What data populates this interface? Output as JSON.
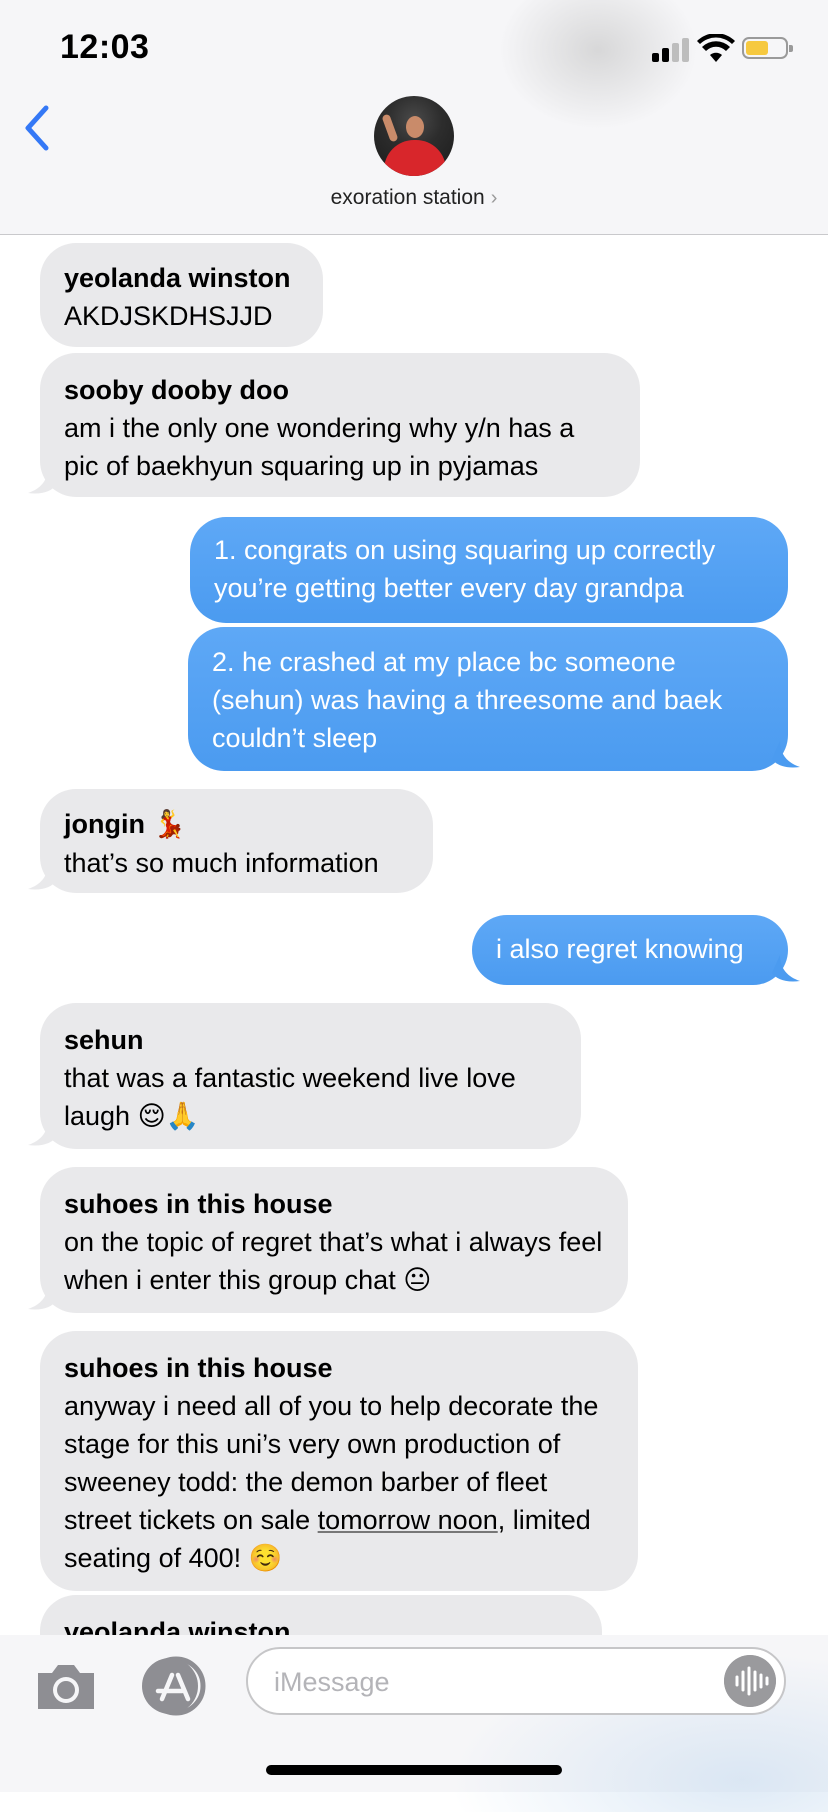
{
  "status_bar": {
    "time": "12:03",
    "battery_color": "#f6c940"
  },
  "header": {
    "contact_name": "exoration station",
    "avatar_icon": "group-avatar"
  },
  "messages": [
    {
      "direction": "in",
      "sender": "yeolanda winston",
      "text": "AKDJSKDHSJJD"
    },
    {
      "direction": "in",
      "sender": "sooby dooby doo",
      "text": "am i the only one wondering why y/n has a pic of baekhyun squaring up in pyjamas"
    },
    {
      "direction": "out",
      "text": "1. congrats on using squaring up correctly you’re getting better every day grandpa"
    },
    {
      "direction": "out",
      "text": "2. he crashed at my place bc someone (sehun) was having a threesome and baek couldn’t sleep"
    },
    {
      "direction": "in",
      "sender": "jongin",
      "sender_emoji": "💃",
      "text": "that’s so much information"
    },
    {
      "direction": "out",
      "text": "i also regret knowing"
    },
    {
      "direction": "in",
      "sender": "sehun",
      "text": "that was a fantastic weekend live love laugh",
      "emoji": "😌🙏"
    },
    {
      "direction": "in",
      "sender": "suhoes in this house",
      "text": "on the topic of regret that’s what i always feel when i enter this group chat",
      "emoji": "😐"
    },
    {
      "direction": "in",
      "sender": "suhoes in this house",
      "text_before_link": "anyway i need all of you to help decorate the stage for this uni’s very own production of sweeney todd: the demon barber of fleet street tickets on sale",
      "link": "tomorrow noon",
      "text_after_link": ", limited seating of 400!",
      "emoji": "☺️"
    },
    {
      "direction": "in",
      "sender": "yeolanda winston",
      "text": ""
    }
  ],
  "composer": {
    "placeholder": "iMessage",
    "value": ""
  },
  "colors": {
    "incoming_bubble": "#e9e9eb",
    "outgoing_bubble": "#4b9bf0",
    "accent": "#3478f6"
  }
}
